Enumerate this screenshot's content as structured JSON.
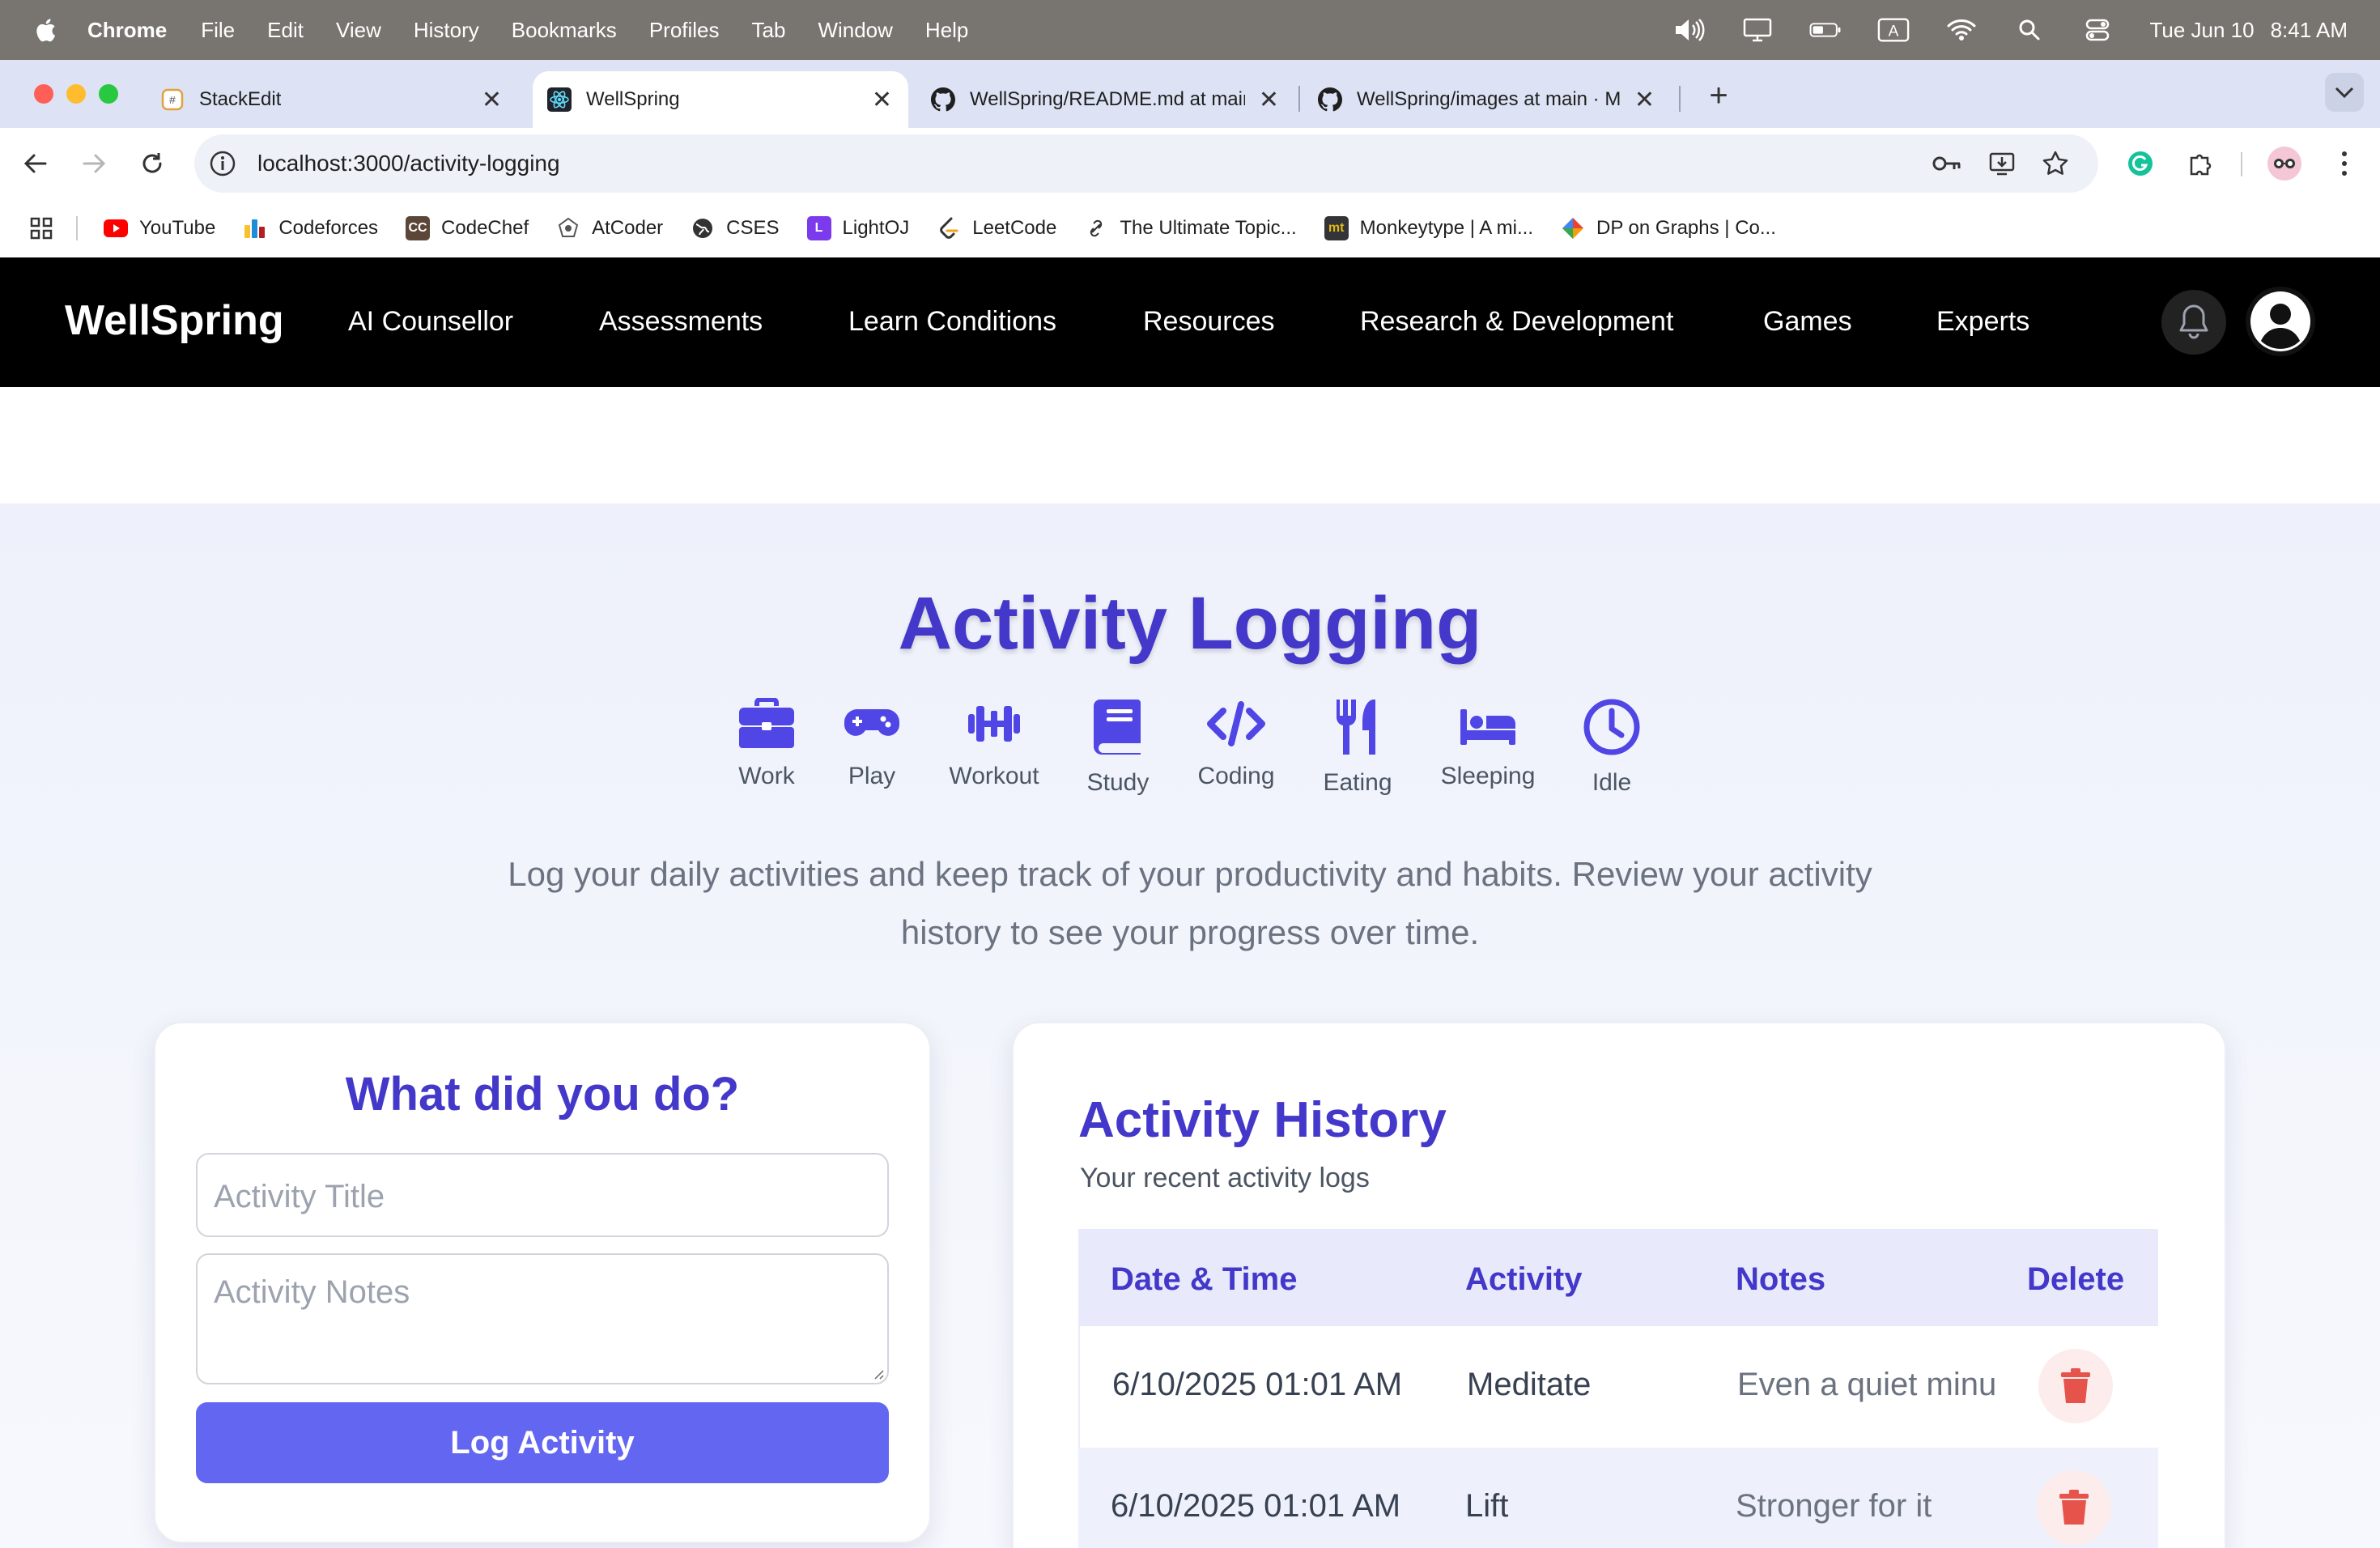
{
  "menubar": {
    "app": "Chrome",
    "items": [
      "File",
      "Edit",
      "View",
      "History",
      "Bookmarks",
      "Profiles",
      "Tab",
      "Window",
      "Help"
    ],
    "date": "Tue Jun 10",
    "time": "8:41 AM",
    "input_indicator": "A"
  },
  "tabs": [
    {
      "title": "StackEdit",
      "icon": "stackedit-icon"
    },
    {
      "title": "WellSpring",
      "icon": "react-icon",
      "active": true
    },
    {
      "title": "WellSpring/README.md at main",
      "icon": "github-icon"
    },
    {
      "title": "WellSpring/images at main · M",
      "icon": "github-icon"
    }
  ],
  "address_bar": {
    "url": "localhost:3000/activity-logging"
  },
  "bookmarks": [
    {
      "label": "YouTube",
      "icon": "youtube-icon",
      "color": "#ff0000"
    },
    {
      "label": "Codeforces",
      "icon": "codeforces-icon",
      "color": "#1f8dd6"
    },
    {
      "label": "CodeChef",
      "icon": "codechef-icon",
      "color": "#5b4638",
      "glyph": "CC"
    },
    {
      "label": "AtCoder",
      "icon": "atcoder-icon",
      "color": "#555555"
    },
    {
      "label": "CSES",
      "icon": "cses-icon",
      "color": "#333333"
    },
    {
      "label": "LightOJ",
      "icon": "lightoj-icon",
      "color": "#7c3aed",
      "glyph": "L"
    },
    {
      "label": "LeetCode",
      "icon": "leetcode-icon",
      "color": "#333333"
    },
    {
      "label": "The Ultimate Topic...",
      "icon": "link-icon",
      "color": "#333333"
    },
    {
      "label": "Monkeytype | A mi...",
      "icon": "monkeytype-icon",
      "color": "#323437",
      "glyph": "mt"
    },
    {
      "label": "DP on Graphs | Co...",
      "icon": "codeforces-blog-icon",
      "color": "#f59e0b"
    }
  ],
  "site": {
    "brand": "WellSpring",
    "nav": [
      "AI Counsellor",
      "Assessments",
      "Learn Conditions",
      "Resources",
      "Research & Development",
      "Games",
      "Experts"
    ]
  },
  "page": {
    "title": "Activity Logging",
    "categories": [
      {
        "label": "Work",
        "icon": "briefcase-icon"
      },
      {
        "label": "Play",
        "icon": "gamepad-icon"
      },
      {
        "label": "Workout",
        "icon": "dumbbell-icon"
      },
      {
        "label": "Study",
        "icon": "book-icon"
      },
      {
        "label": "Coding",
        "icon": "code-icon"
      },
      {
        "label": "Eating",
        "icon": "utensils-icon"
      },
      {
        "label": "Sleeping",
        "icon": "bed-icon"
      },
      {
        "label": "Idle",
        "icon": "clock-icon"
      }
    ],
    "intro": "Log your daily activities and keep track of your productivity and habits. Review your activity history to see your progress over time.",
    "form": {
      "title": "What did you do?",
      "title_placeholder": "Activity Title",
      "notes_placeholder": "Activity Notes",
      "submit": "Log Activity"
    },
    "history": {
      "title": "Activity History",
      "subtitle": "Your recent activity logs",
      "columns": [
        "Date & Time",
        "Activity",
        "Notes",
        "Delete"
      ],
      "rows": [
        {
          "datetime": "6/10/2025 01:01 AM",
          "activity": "Meditate",
          "notes": "Even a quiet minu"
        },
        {
          "datetime": "6/10/2025 01:01 AM",
          "activity": "Lift",
          "notes": "Stronger for it"
        }
      ]
    }
  },
  "colors": {
    "accent": "#4338ca",
    "button": "#6366f1",
    "delete": "#e5534b",
    "nav_bg": "#000000"
  }
}
